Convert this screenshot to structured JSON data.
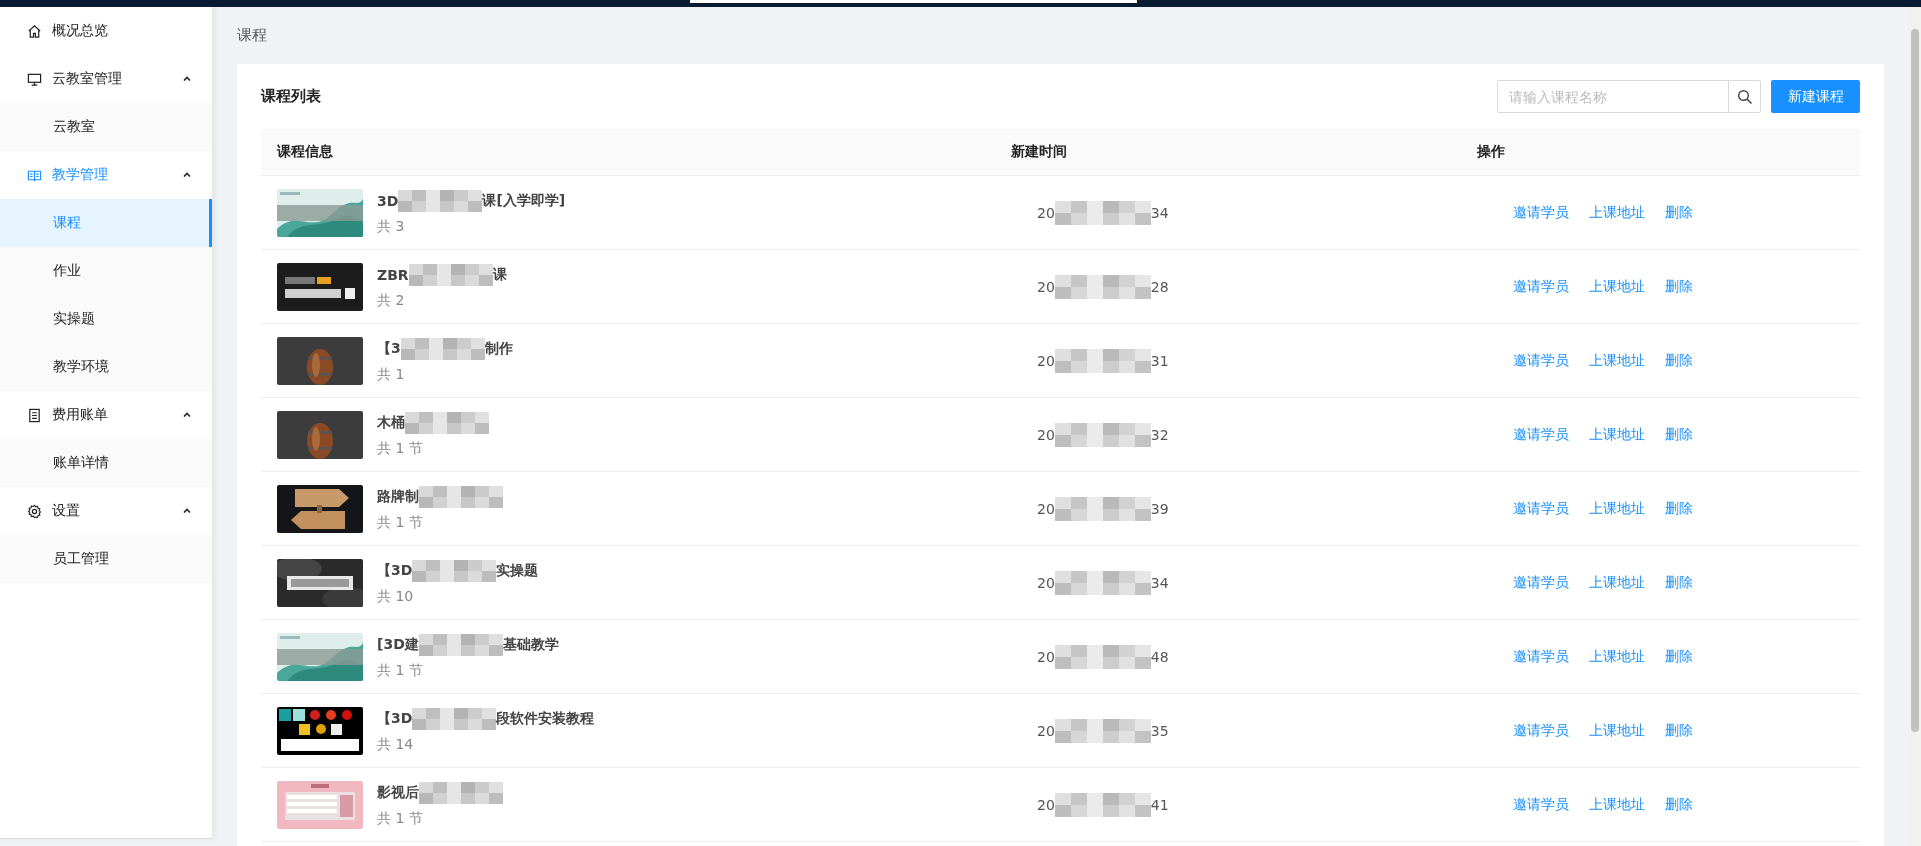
{
  "breadcrumb": "课程",
  "sidebar": {
    "items": [
      {
        "label": "概况总览",
        "active": false
      },
      {
        "label": "云教室管理",
        "active": false,
        "expanded": true,
        "children": [
          {
            "label": "云教室",
            "selected": false
          }
        ]
      },
      {
        "label": "教学管理",
        "active": true,
        "expanded": true,
        "children": [
          {
            "label": "课程",
            "selected": true
          },
          {
            "label": "作业",
            "selected": false
          },
          {
            "label": "实操题",
            "selected": false
          },
          {
            "label": "教学环境",
            "selected": false
          }
        ]
      },
      {
        "label": "费用账单",
        "active": false,
        "expanded": true,
        "children": [
          {
            "label": "账单详情",
            "selected": false
          }
        ]
      },
      {
        "label": "设置",
        "active": false,
        "expanded": true,
        "children": [
          {
            "label": "员工管理",
            "selected": false
          }
        ]
      }
    ]
  },
  "card": {
    "title": "课程列表",
    "search": {
      "placeholder": "请输入课程名称"
    },
    "new_button": "新建课程"
  },
  "table": {
    "columns": [
      "课程信息",
      "新建时间",
      "操作"
    ],
    "rows": [
      {
        "title_start": "3D",
        "title_end": "课[入学即学]",
        "lessons": "共 3",
        "time_start": "20",
        "time_end": "34",
        "actions": [
          "邀请学员",
          "上课地址",
          "删除"
        ]
      },
      {
        "title_start": "ZBR",
        "title_end": "课",
        "lessons": "共 2",
        "time_start": "20",
        "time_end": "28",
        "actions": [
          "邀请学员",
          "上课地址",
          "删除"
        ]
      },
      {
        "title_start": "【3",
        "title_end": "制作",
        "lessons": "共 1",
        "time_start": "20",
        "time_end": "31",
        "actions": [
          "邀请学员",
          "上课地址",
          "删除"
        ]
      },
      {
        "title_start": "木桶",
        "title_end": "",
        "lessons": "共 1 节",
        "time_start": "20",
        "time_end": "32",
        "actions": [
          "邀请学员",
          "上课地址",
          "删除"
        ]
      },
      {
        "title_start": "路牌制",
        "title_end": "",
        "lessons": "共 1 节",
        "time_start": "20",
        "time_end": "39",
        "actions": [
          "邀请学员",
          "上课地址",
          "删除"
        ]
      },
      {
        "title_start": "【3D",
        "title_end": "实操题",
        "lessons": "共 10",
        "time_start": "20",
        "time_end": "34",
        "actions": [
          "邀请学员",
          "上课地址",
          "删除"
        ]
      },
      {
        "title_start": "[3D建",
        "title_end": "基础教学",
        "lessons": "共 1 节",
        "time_start": "20",
        "time_end": "48",
        "actions": [
          "邀请学员",
          "上课地址",
          "删除"
        ]
      },
      {
        "title_start": "【3D",
        "title_end": "段软件安装教程",
        "lessons": "共 14",
        "time_start": "20",
        "time_end": "35",
        "actions": [
          "邀请学员",
          "上课地址",
          "删除"
        ]
      },
      {
        "title_start": "影视后",
        "title_end": "",
        "lessons": "共 1 节",
        "time_start": "20",
        "time_end": "41",
        "actions": [
          "邀请学员",
          "上课地址",
          "删除"
        ]
      }
    ]
  }
}
